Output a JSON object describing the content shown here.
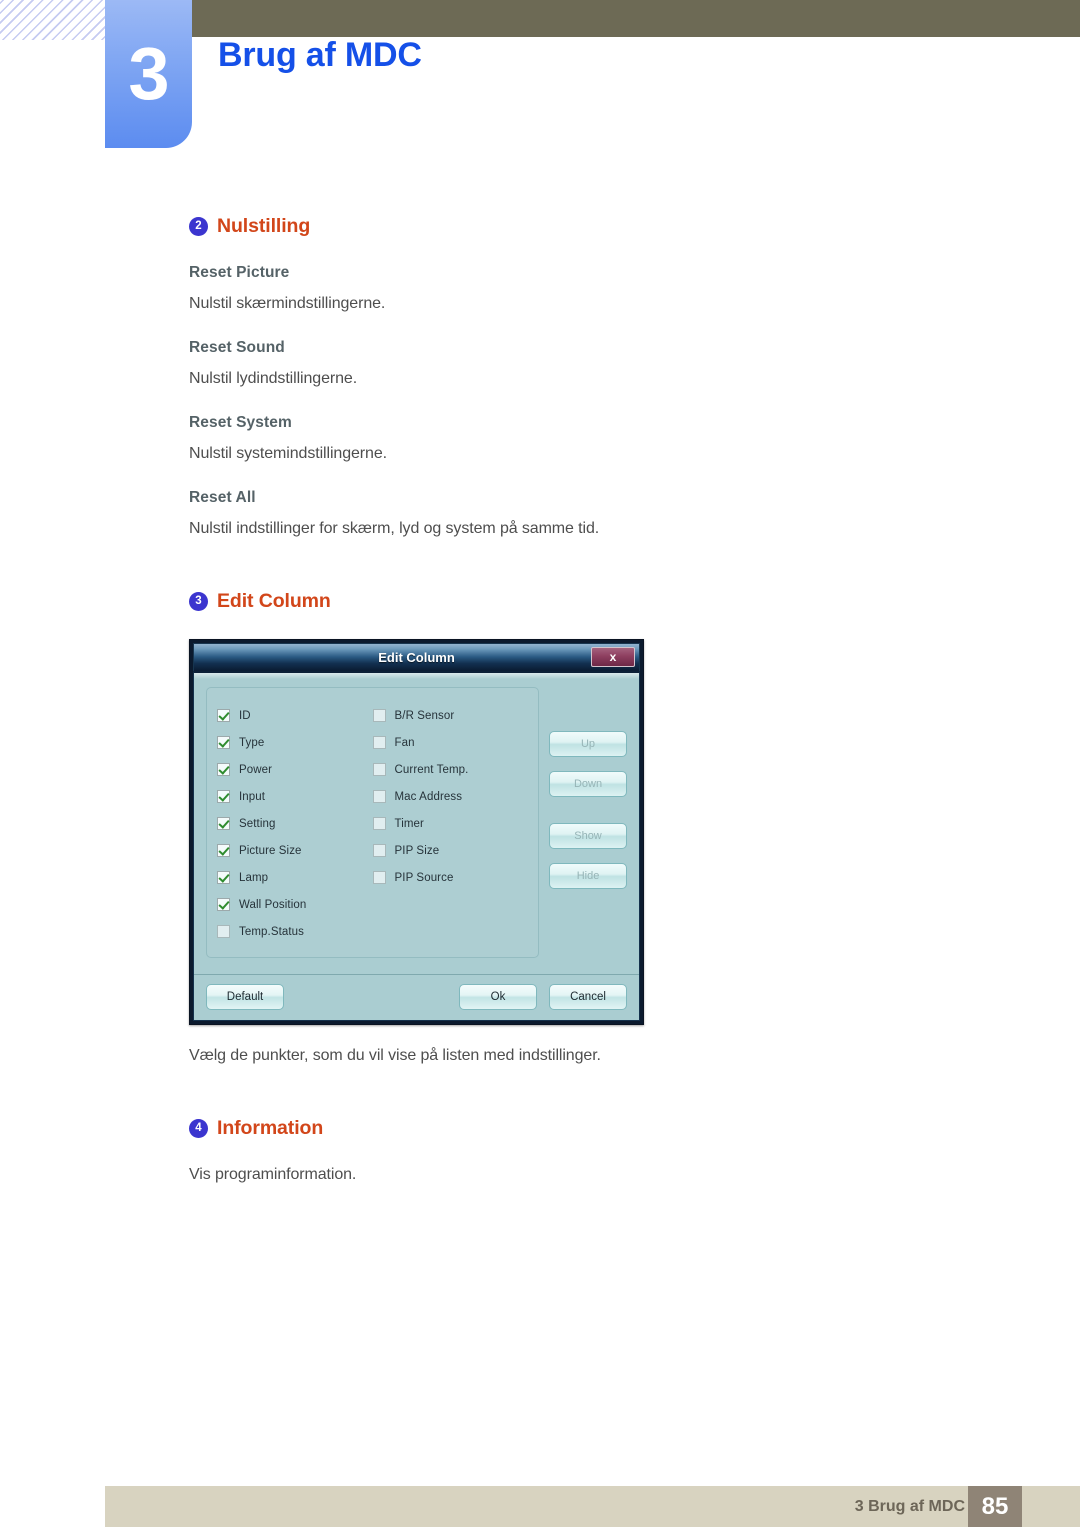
{
  "header": {
    "chapter_number": "3",
    "chapter_title": "Brug af MDC"
  },
  "sections": {
    "nulstilling": {
      "badge": "2",
      "title": "Nulstilling",
      "items": [
        {
          "heading": "Reset Picture",
          "text": "Nulstil skærmindstillingerne."
        },
        {
          "heading": "Reset Sound",
          "text": "Nulstil lydindstillingerne."
        },
        {
          "heading": "Reset System",
          "text": "Nulstil systemindstillingerne."
        },
        {
          "heading": "Reset All",
          "text": "Nulstil indstillinger for skærm, lyd og system på samme tid."
        }
      ]
    },
    "edit_column": {
      "badge": "3",
      "title": "Edit Column",
      "caption": "Vælg de punkter, som du vil vise på listen med indstillinger."
    },
    "information": {
      "badge": "4",
      "title": "Information",
      "text": "Vis programinformation."
    }
  },
  "dialog": {
    "title": "Edit Column",
    "close_label": "x",
    "checkbox_columns": [
      [
        {
          "label": "ID",
          "checked": true
        },
        {
          "label": "Type",
          "checked": true
        },
        {
          "label": "Power",
          "checked": true
        },
        {
          "label": "Input",
          "checked": true
        },
        {
          "label": "Setting",
          "checked": true
        },
        {
          "label": "Picture Size",
          "checked": true
        },
        {
          "label": "Lamp",
          "checked": true
        },
        {
          "label": "Wall Position",
          "checked": true
        },
        {
          "label": "Temp.Status",
          "checked": false
        }
      ],
      [
        {
          "label": "B/R Sensor",
          "checked": false
        },
        {
          "label": "Fan",
          "checked": false
        },
        {
          "label": "Current Temp.",
          "checked": false
        },
        {
          "label": "Mac Address",
          "checked": false
        },
        {
          "label": "Timer",
          "checked": false
        },
        {
          "label": "PIP Size",
          "checked": false
        },
        {
          "label": "PIP Source",
          "checked": false
        }
      ]
    ],
    "side_buttons": [
      {
        "label": "Up",
        "enabled": false
      },
      {
        "label": "Down",
        "enabled": false
      },
      {
        "label": "Show",
        "enabled": false
      },
      {
        "label": "Hide",
        "enabled": false
      }
    ],
    "footer_buttons": {
      "default": "Default",
      "ok": "Ok",
      "cancel": "Cancel"
    }
  },
  "footer": {
    "label": "3 Brug af MDC",
    "page_number": "85"
  },
  "colors": {
    "chapter_tab": "#5c8cf0",
    "chapter_title": "#1550e8",
    "olive_bar": "#6d6a55",
    "section_title": "#d2461a",
    "badge": "#3b35cf",
    "sub_head": "#556267",
    "body_text": "#4e4e4e",
    "footer_bar": "#d8d3c0",
    "footer_page_box": "#8f8476",
    "dialog_body": "#aacdd1",
    "dialog_close": "#8e3f60",
    "checkmark": "#2f8c2f"
  }
}
